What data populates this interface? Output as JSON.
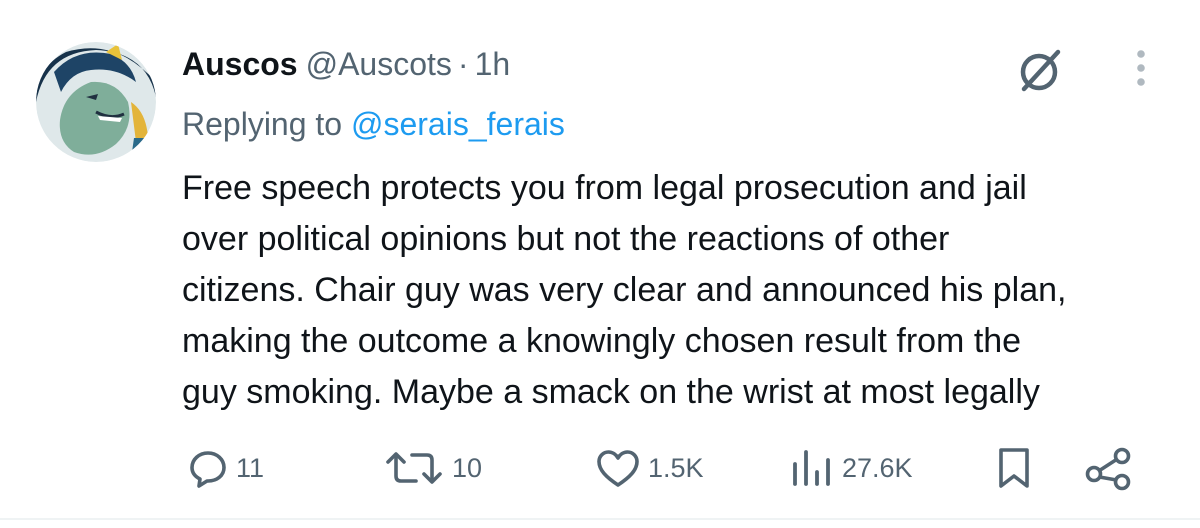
{
  "tweet": {
    "author": {
      "display_name": "Auscos",
      "handle": "@Auscots",
      "separator": "·",
      "time": "1h"
    },
    "reply": {
      "prefix": "Replying to",
      "mention": "@serais_ferais"
    },
    "text": "Free speech protects you from legal prosecution and jail\nover political opinions but not the reactions of other\ncitizens. Chair guy was very clear and announced his plan,\nmaking the outcome a knowingly chosen result from the\nguy smoking. Maybe a smack on the wrist at most legally",
    "actions": {
      "replies": "11",
      "reposts": "10",
      "likes": "1.5K",
      "views": "27.6K"
    }
  },
  "colors": {
    "text_primary": "#0f1419",
    "text_secondary": "#536471",
    "link": "#1d9bf0",
    "divider": "#eff3f4"
  },
  "icons": [
    "avatar",
    "grok-icon",
    "more-icon",
    "reply-icon",
    "repost-icon",
    "like-icon",
    "views-icon",
    "bookmark-icon",
    "share-icon"
  ]
}
